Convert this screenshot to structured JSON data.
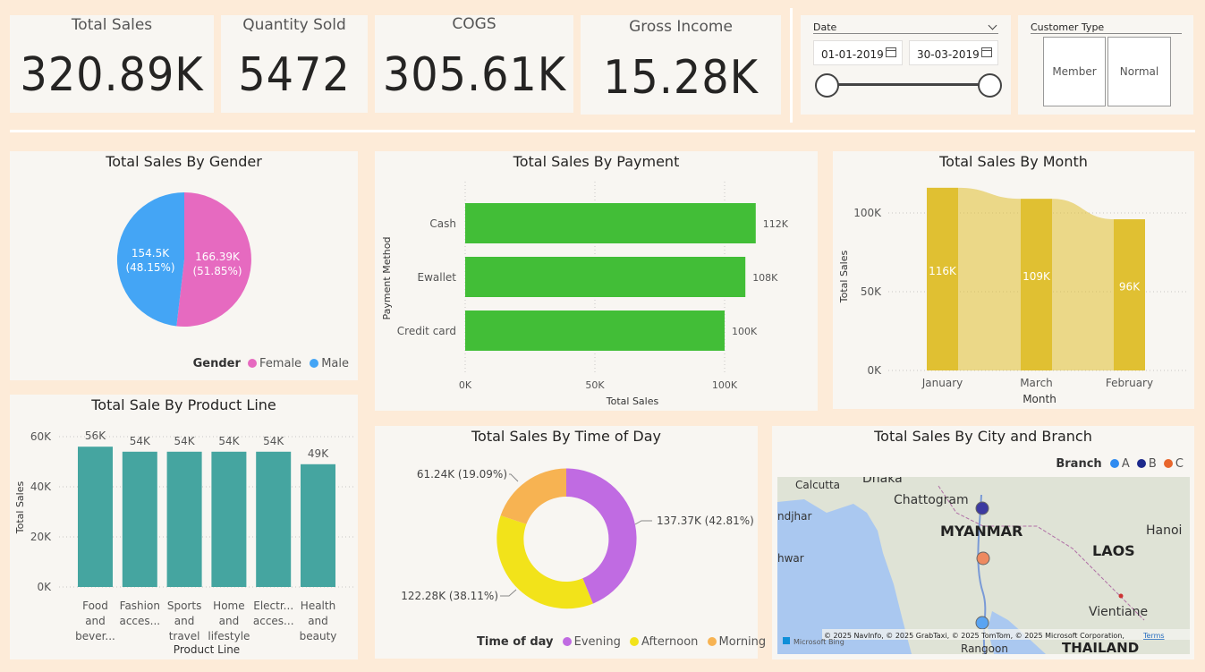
{
  "kpis": [
    {
      "title": "Total Sales",
      "value": "320.89K"
    },
    {
      "title": "Quantity Sold",
      "value": "5472"
    },
    {
      "title": "COGS",
      "value": "305.61K"
    },
    {
      "title": "Gross Income",
      "value": "15.28K"
    }
  ],
  "date_slicer": {
    "label": "Date",
    "start": "01-01-2019",
    "end": "30-03-2019",
    "icon": "calendar-icon"
  },
  "customer_slicer": {
    "label": "Customer Type",
    "options": [
      "Member",
      "Normal"
    ]
  },
  "gender_chart": {
    "title": "Total Sales By Gender",
    "legend_title": "Gender",
    "labels": [
      "166.39K",
      "(51.85%)",
      "154.5K",
      "(48.15%)"
    ],
    "colors": {
      "Female": "#e66ac0",
      "Male": "#44a5f5"
    }
  },
  "payment_chart": {
    "title": "Total Sales By Payment",
    "ylabel": "Payment Method",
    "xlabel": "Total Sales",
    "ticks": [
      "0K",
      "50K",
      "100K"
    ],
    "data_labels": [
      "112K",
      "108K",
      "100K"
    ],
    "color": "#42be37"
  },
  "month_chart": {
    "title": "Total Sales By Month",
    "ylabel": "Total Sales",
    "xlabel": "Month",
    "ticks": [
      "100K",
      "50K",
      "0K"
    ],
    "data_labels": [
      "116K",
      "109K",
      "96K"
    ],
    "color": "#e0c032"
  },
  "product_chart": {
    "title": "Total Sale By Product Line",
    "ylabel": "Total Sales",
    "xlabel": "Product Line",
    "ticks": [
      "60K",
      "40K",
      "20K",
      "0K"
    ],
    "data_labels": [
      "56K",
      "54K",
      "54K",
      "54K",
      "54K",
      "49K"
    ],
    "category_lines": [
      [
        "Food",
        "and",
        "bever..."
      ],
      [
        "Fashion",
        "acces..."
      ],
      [
        "Sports",
        "and",
        "travel"
      ],
      [
        "Home",
        "and",
        "lifestyle"
      ],
      [
        "Electr...",
        "acces..."
      ],
      [
        "Health",
        "and",
        "beauty"
      ]
    ],
    "color": "#45a5a0"
  },
  "time_chart": {
    "title": "Total Sales By Time of Day",
    "legend_title": "Time of day",
    "labels": [
      "137.37K (42.81%)",
      "122.28K (38.11%)",
      "61.24K (19.09%)"
    ],
    "colors": {
      "Evening": "#c06be2",
      "Afternoon": "#f2e31a",
      "Morning": "#f7b352"
    }
  },
  "map": {
    "title": "Total Sales By City and Branch",
    "legend_title": "Branch",
    "legend": [
      {
        "name": "A",
        "color": "#2f8bf0"
      },
      {
        "name": "B",
        "color": "#1d2a8c"
      },
      {
        "name": "C",
        "color": "#e8662c"
      }
    ],
    "places": [
      "Dhaka",
      "Calcutta",
      "Chattogram",
      "ndjhar",
      "MYANMAR",
      "Hanoi",
      "LAOS",
      "hwar",
      "Vientiane",
      "Rangoon",
      "THAILAND"
    ],
    "attribution": "© 2025 NavInfo, © 2025 GrabTaxi, © 2025 TomTom, © 2025 Microsoft Corporation,",
    "terms": "Terms",
    "bing": "Microsoft Bing"
  },
  "chart_data": [
    {
      "type": "pie",
      "title": "Total Sales By Gender",
      "categories": [
        "Female",
        "Male"
      ],
      "values": [
        166.39,
        154.5
      ],
      "unit": "K",
      "percents": [
        51.85,
        48.15
      ],
      "legend": "bottom-right"
    },
    {
      "type": "bar",
      "orientation": "horizontal",
      "title": "Total Sales By Payment",
      "categories": [
        "Cash",
        "Ewallet",
        "Credit card"
      ],
      "values": [
        112,
        108,
        100
      ],
      "unit": "K",
      "xlabel": "Total Sales",
      "ylabel": "Payment Method",
      "xlim": [
        0,
        120
      ],
      "grid": true
    },
    {
      "type": "area",
      "title": "Total Sales By Month",
      "categories": [
        "January",
        "March",
        "February"
      ],
      "values": [
        116,
        109,
        96
      ],
      "unit": "K",
      "xlabel": "Month",
      "ylabel": "Total Sales",
      "ylim": [
        0,
        116
      ],
      "grid": true
    },
    {
      "type": "bar",
      "title": "Total Sale By Product Line",
      "categories": [
        "Food and bever...",
        "Fashion acces...",
        "Sports and travel",
        "Home and lifestyle",
        "Electr... acces...",
        "Health and beauty"
      ],
      "values": [
        56,
        54,
        54,
        54,
        54,
        49
      ],
      "unit": "K",
      "xlabel": "Product Line",
      "ylabel": "Total Sales",
      "ylim": [
        0,
        60
      ],
      "grid": true
    },
    {
      "type": "pie",
      "subtype": "donut",
      "title": "Total Sales By Time of Day",
      "categories": [
        "Evening",
        "Afternoon",
        "Morning"
      ],
      "values": [
        137.37,
        122.28,
        61.24
      ],
      "unit": "K",
      "percents": [
        42.81,
        38.11,
        19.09
      ],
      "legend": "bottom"
    }
  ]
}
